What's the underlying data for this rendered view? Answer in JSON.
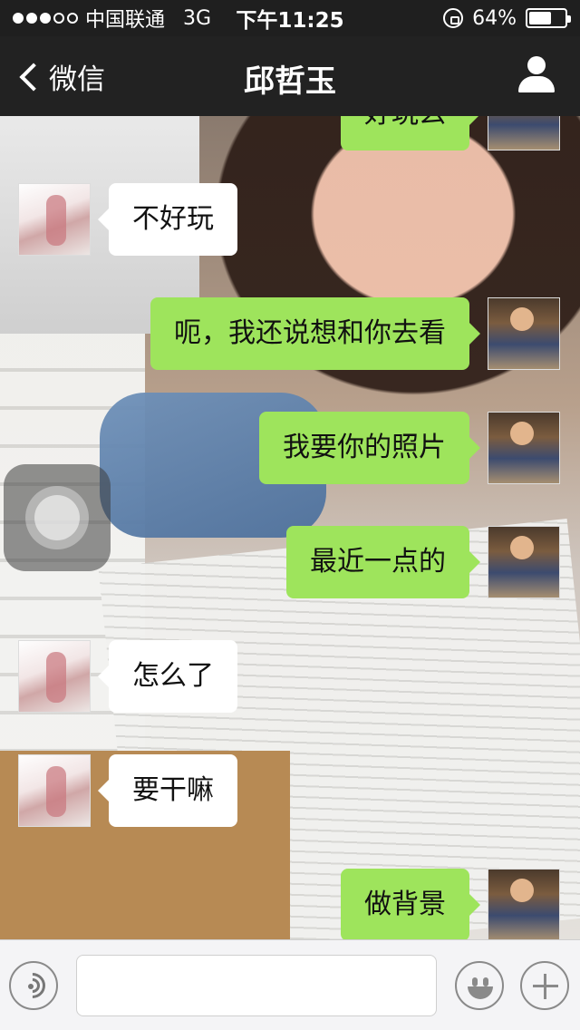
{
  "status_bar": {
    "carrier": "中国联通",
    "network": "3G",
    "time": "下午11:25",
    "battery_text": "64%",
    "battery_level": 0.64,
    "signal_bars_filled": 3,
    "signal_bars_total": 5
  },
  "nav": {
    "back_label": "微信",
    "title": "邱哲玉"
  },
  "messages": [
    {
      "side": "right",
      "text": "好玩么"
    },
    {
      "side": "left",
      "text": "不好玩"
    },
    {
      "side": "right",
      "text": "呃，我还说想和你去看"
    },
    {
      "side": "right",
      "text": "我要你的照片"
    },
    {
      "side": "right",
      "text": "最近一点的"
    },
    {
      "side": "left",
      "text": "怎么了"
    },
    {
      "side": "left",
      "text": "要干嘛"
    },
    {
      "side": "right",
      "text": "做背景"
    }
  ],
  "input": {
    "value": "",
    "placeholder": ""
  },
  "colors": {
    "nav_background": "#222222",
    "own_bubble": "#9ee45c",
    "other_bubble": "#ffffff"
  },
  "icons": [
    "back-chevron-icon",
    "profile-icon",
    "voice-icon",
    "emoji-icon",
    "plus-icon",
    "lock-rotation-icon",
    "battery-icon"
  ]
}
